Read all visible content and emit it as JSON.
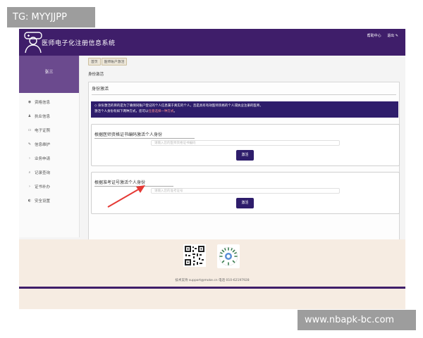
{
  "header": {
    "app_title": "医师电子化注册信息系统",
    "links": [
      "帮助中心",
      "退出 ✎"
    ]
  },
  "sidebar": {
    "user_name": "张三",
    "items": [
      {
        "icon": "info-icon",
        "glyph": "◉",
        "label": "资格信息"
      },
      {
        "icon": "user-group-icon",
        "glyph": "♟",
        "label": "执业信息"
      },
      {
        "icon": "id-card-icon",
        "glyph": "▭",
        "label": "电子证照"
      },
      {
        "icon": "edit-icon",
        "glyph": "✎",
        "label": "信息维护"
      },
      {
        "icon": "chevron-right-icon",
        "glyph": "›",
        "label": "业务申请"
      },
      {
        "icon": "search-icon",
        "glyph": "⌕",
        "label": "记录查询"
      },
      {
        "icon": "chevron-right-icon",
        "glyph": "›",
        "label": "证书补办"
      },
      {
        "icon": "settings-icon",
        "glyph": "◐",
        "label": "安全设置"
      }
    ]
  },
  "breadcrumb": [
    "首页",
    "医师账户激活"
  ],
  "page_heading": "身份激活",
  "panel": {
    "title": "身份激活",
    "notice_line1": "◇ 身份激活的目的是为了确保同账户登记的个人信息属于真实的个人，且是具有有效医师资格的个人或执业注册的医师。",
    "notice_line2_prefix": "激活个人身份有如下两种方式，您可以",
    "notice_line2_highlight": "任意选择一种方式",
    "notice_line2_suffix": "。"
  },
  "cert_box": {
    "title": "根据医师资格证书编码激活个人身份",
    "placeholder": "请输入您的医师资格证书编码",
    "button": "激活"
  },
  "exam_box": {
    "title": "根据准考证号激活个人身份",
    "placeholder": "请输入您的准考证号",
    "button": "激活"
  },
  "footer": {
    "contact": "技术支持 support@moke.cn  电话 010-62197928"
  },
  "watermarks": {
    "top_left": "TG: MYYJJPP",
    "bottom_right": "www.nbapk-bc.com"
  },
  "colors": {
    "brand": "#3f1e6a",
    "profile": "#6b4a8e",
    "notice": "#2e1d6b",
    "footer_bg": "#f6ece2",
    "annotation_arrow": "#e53935"
  }
}
